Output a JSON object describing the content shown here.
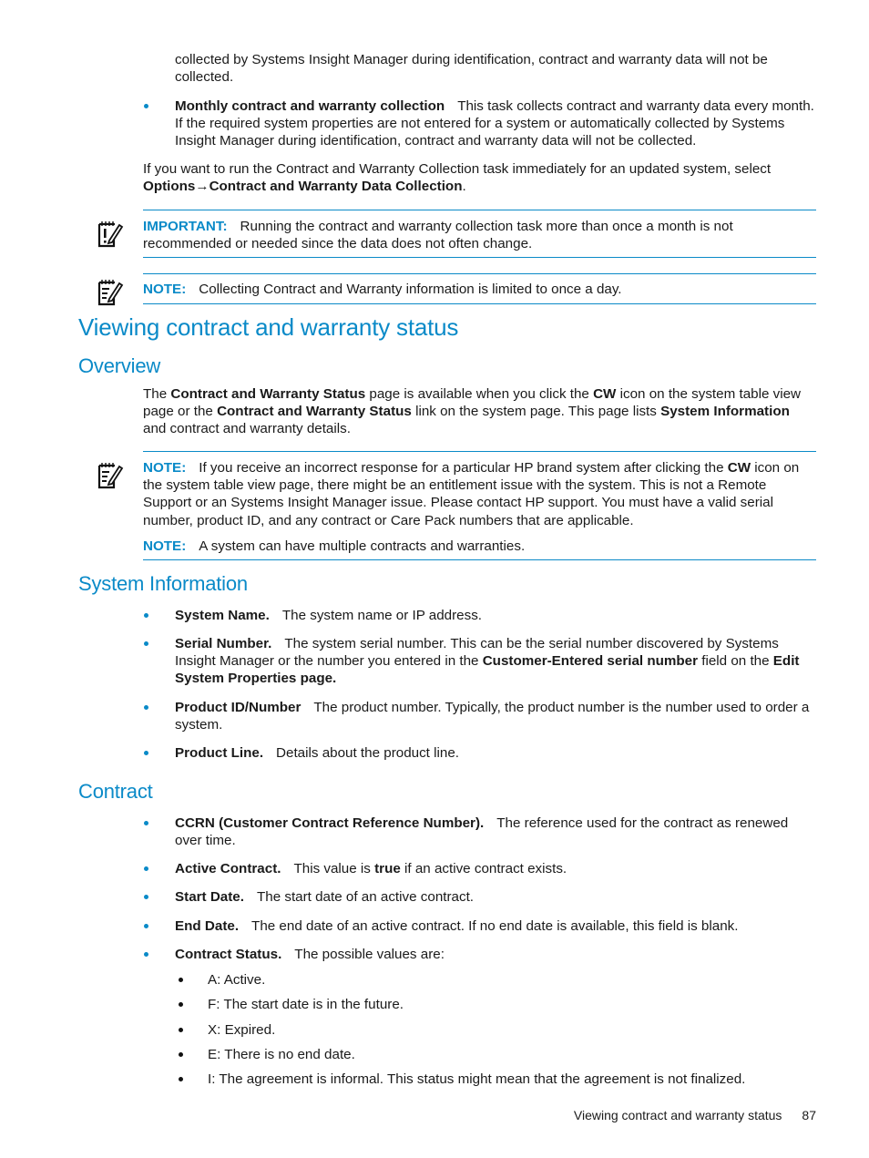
{
  "intro": {
    "continuation": "collected by Systems Insight Manager during identification, contract and warranty data will not be collected.",
    "monthly_item": {
      "term": "Monthly contract and warranty collection",
      "desc": "This task collects contract and warranty data every month. If the required system properties are not entered for a system or automatically collected by Systems Insight Manager during identification, contract and warranty data will not be collected."
    },
    "run_now": {
      "text": "If you want to run the Contract and Warranty Collection task immediately for an updated system, select",
      "menu_path_1": "Options",
      "arrow": "→",
      "menu_path_2": "Contract and Warranty Data Collection",
      "end": "."
    }
  },
  "important_box": {
    "icon": "important-note-icon",
    "label": "IMPORTANT:",
    "text": "Running the contract and warranty collection task more than once a month is not recommended or needed since the data does not often change."
  },
  "note_box_1": {
    "icon": "note-pencil-icon",
    "label": "NOTE:",
    "text": "Collecting Contract and Warranty information is limited to once a day."
  },
  "section": {
    "title": "Viewing contract and warranty status"
  },
  "overview": {
    "title": "Overview",
    "p1": "The ",
    "b1": "Contract and Warranty Status",
    "p2": " page is available when you click the ",
    "b2": "CW",
    "p3": " icon on the system table view page or the ",
    "b3": "Contract and Warranty Status",
    "p4": " link on the system page. This page lists ",
    "b4": "System Information",
    "p5": " and contract and warranty details."
  },
  "note_box_2": {
    "icon": "note-pencil-icon",
    "label": "NOTE:",
    "text_1": "If you receive an incorrect response for a particular HP brand system after clicking the ",
    "bold": "CW",
    "text_2": " icon on the system table view page, there might be an entitlement issue with the system. This is not a Remote Support or an Systems Insight Manager issue. Please contact HP support. You must have a valid serial number, product ID, and any contract or Care Pack numbers that are applicable.",
    "label_2": "NOTE:",
    "text_3": "A system can have multiple contracts and warranties."
  },
  "system_information": {
    "title": "System Information",
    "items": [
      {
        "term": "System Name.",
        "desc": "The system name or IP address."
      },
      {
        "term": "Serial Number.",
        "desc_1": "The system serial number. This can be the serial number discovered by Systems Insight Manager or the number you entered in the ",
        "bold_1": "Customer-Entered serial number",
        "desc_2": " field on the ",
        "bold_2": "Edit System Properties page."
      },
      {
        "term": "Product ID/Number",
        "desc": "The product number. Typically, the product number is the number used to order a system."
      },
      {
        "term": "Product Line.",
        "desc": "Details about the product line."
      }
    ]
  },
  "contract": {
    "title": "Contract",
    "items": [
      {
        "term": "CCRN (Customer Contract Reference Number).",
        "desc": "The reference used for the contract as renewed over time."
      },
      {
        "term": "Active Contract.",
        "desc_1": "This value is ",
        "bold": "true",
        "desc_2": " if an active contract exists."
      },
      {
        "term": "Start Date.",
        "desc": "The start date of an active contract."
      },
      {
        "term": "End Date.",
        "desc": "The end date of an active contract. If no end date is available, this field is blank."
      },
      {
        "term": "Contract Status.",
        "desc": "The possible values are:"
      }
    ],
    "status_values": [
      "A: Active.",
      "F: The start date is in the future.",
      "X: Expired.",
      "E: There is no end date.",
      "I: The agreement is informal. This status might mean that the agreement is not finalized."
    ]
  },
  "footer": {
    "running_title": "Viewing contract and warranty status",
    "page_number": "87"
  }
}
